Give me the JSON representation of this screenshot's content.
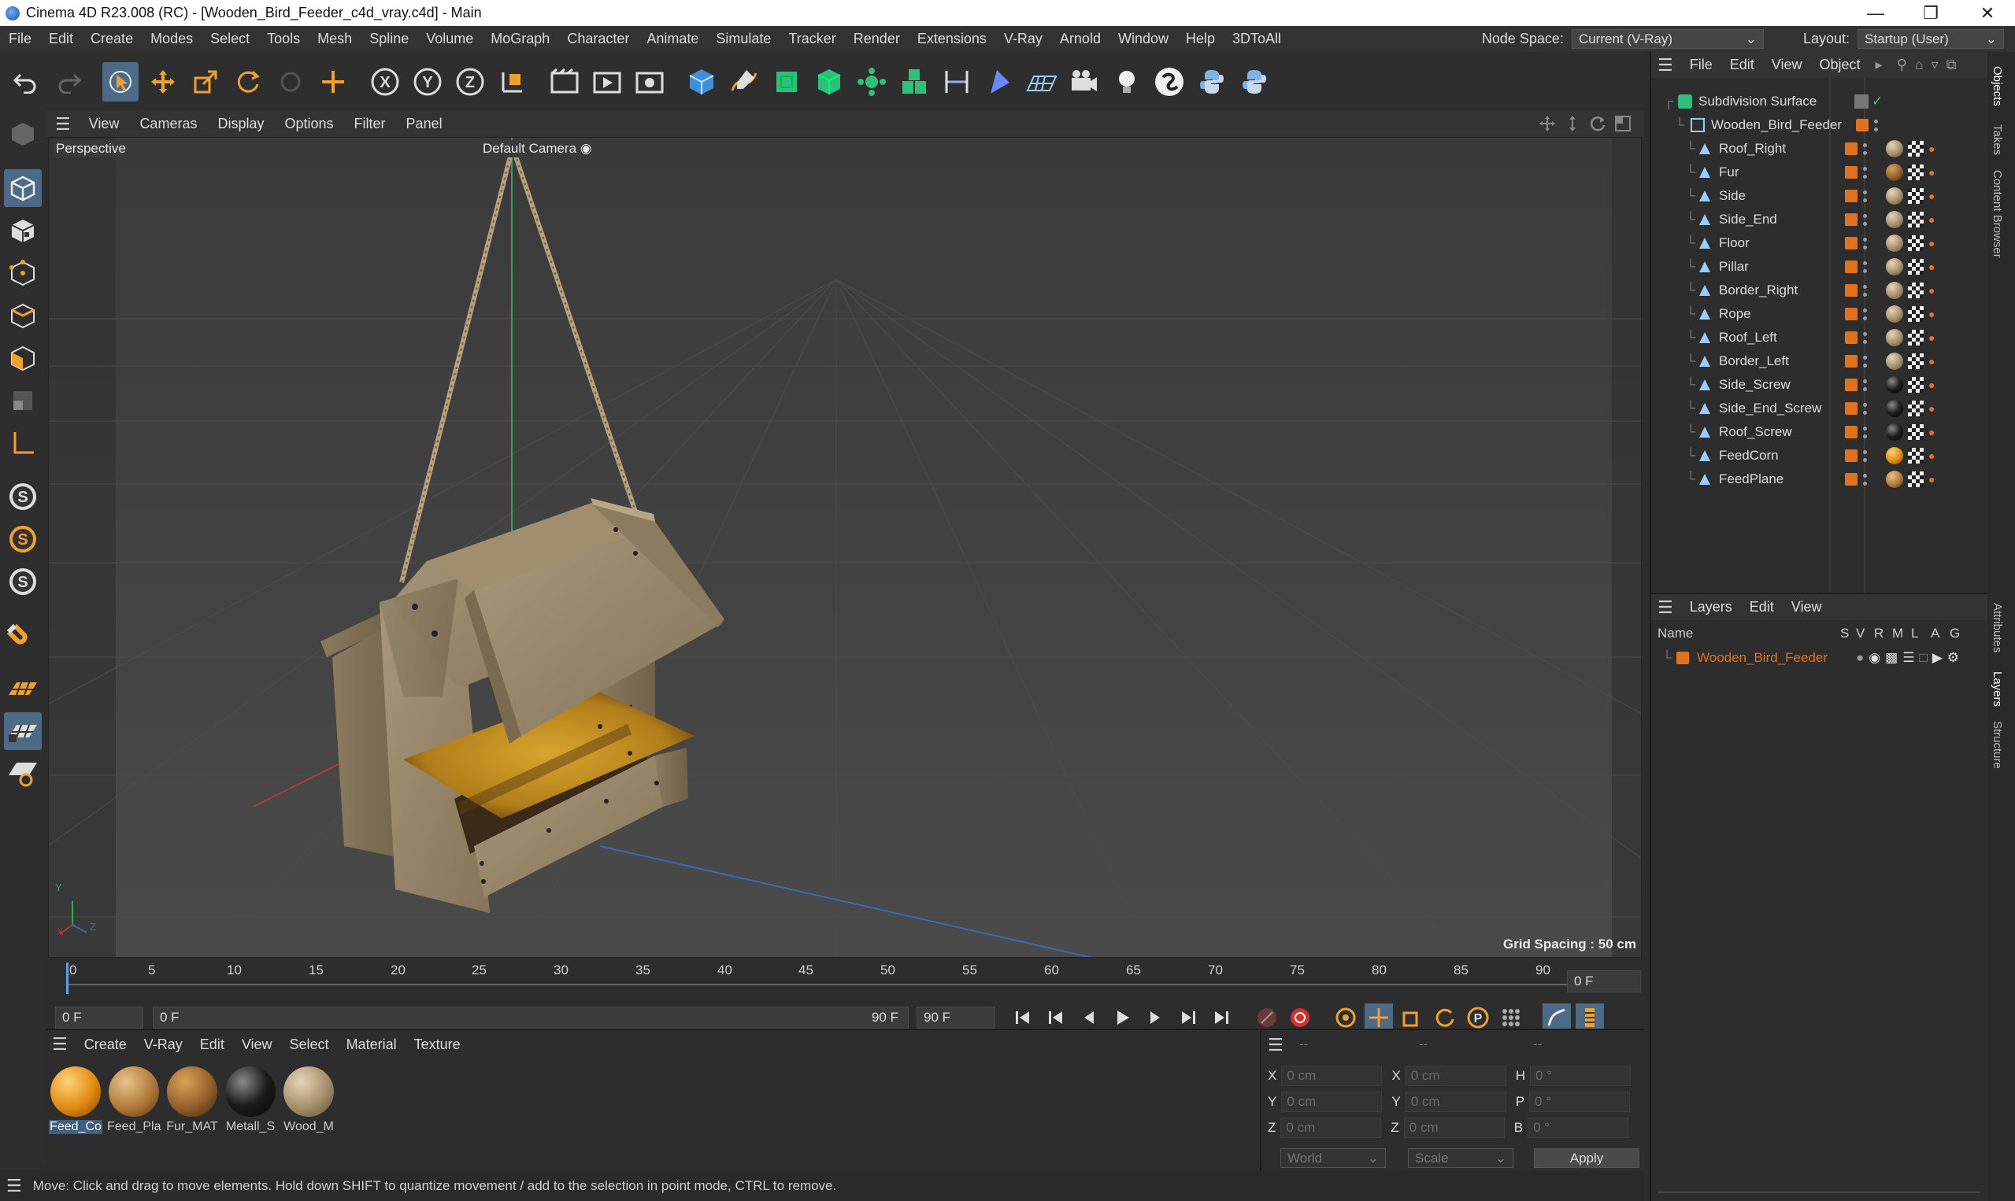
{
  "window": {
    "title": "Cinema 4D R23.008 (RC) - [Wooden_Bird_Feeder_c4d_vray.c4d] - Main"
  },
  "menu": [
    "File",
    "Edit",
    "Create",
    "Modes",
    "Select",
    "Tools",
    "Mesh",
    "Spline",
    "Volume",
    "MoGraph",
    "Character",
    "Animate",
    "Simulate",
    "Tracker",
    "Render",
    "Extensions",
    "V-Ray",
    "Arnold",
    "Window",
    "Help",
    "3DToAll"
  ],
  "node_space": {
    "label": "Node Space:",
    "value": "Current (V-Ray)"
  },
  "layout": {
    "label": "Layout:",
    "value": "Startup (User)"
  },
  "viewport": {
    "menu": [
      "View",
      "Cameras",
      "Display",
      "Options",
      "Filter",
      "Panel"
    ],
    "name": "Perspective",
    "camera": "Default Camera",
    "grid_spacing": "Grid Spacing : 50 cm",
    "axis_x": "X",
    "axis_y": "Y",
    "axis_z": "Z"
  },
  "timeline": {
    "ticks": [
      "0",
      "5",
      "10",
      "15",
      "20",
      "25",
      "30",
      "35",
      "40",
      "45",
      "50",
      "55",
      "60",
      "65",
      "70",
      "75",
      "80",
      "85",
      "90"
    ],
    "current": "0 F"
  },
  "transport": {
    "start": "0 F",
    "range_start": "0 F",
    "range_end": "90 F",
    "end": "90 F"
  },
  "materials": {
    "menu": [
      "Create",
      "V-Ray",
      "Edit",
      "View",
      "Select",
      "Material",
      "Texture"
    ],
    "items": [
      {
        "label": "Feed_Co"
      },
      {
        "label": "Feed_Pla"
      },
      {
        "label": "Fur_MAT"
      },
      {
        "label": "Metall_S"
      },
      {
        "label": "Wood_M"
      }
    ]
  },
  "coords": {
    "header": [
      "--",
      "--",
      "--"
    ],
    "rows": [
      {
        "a": "X",
        "av": "0 cm",
        "b": "X",
        "bv": "0 cm",
        "c": "H",
        "cv": "0 °"
      },
      {
        "a": "Y",
        "av": "0 cm",
        "b": "Y",
        "bv": "0 cm",
        "c": "P",
        "cv": "0 °"
      },
      {
        "a": "Z",
        "av": "0 cm",
        "b": "Z",
        "bv": "0 cm",
        "c": "B",
        "cv": "0 °"
      }
    ],
    "world": "World",
    "scale": "Scale",
    "apply": "Apply"
  },
  "status": "Move: Click and drag to move elements. Hold down SHIFT to quantize movement / add to the selection in point mode, CTRL to remove.",
  "objects": {
    "menu": [
      "File",
      "Edit",
      "View",
      "Object"
    ],
    "root": "Subdivision Surface",
    "group": "Wooden_Bird_Feeder",
    "children": [
      "Roof_Right",
      "Fur",
      "Side",
      "Side_End",
      "Floor",
      "Pillar",
      "Border_Right",
      "Rope",
      "Roof_Left",
      "Border_Left",
      "Side_Screw",
      "Side_End_Screw",
      "Roof_Screw",
      "FeedCorn",
      "FeedPlane"
    ]
  },
  "layers": {
    "menu": [
      "Layers",
      "Edit",
      "View"
    ],
    "columns": [
      "Name",
      "S",
      "V",
      "R",
      "M",
      "L",
      "A",
      "G"
    ],
    "items": [
      "Wooden_Bird_Feeder"
    ]
  },
  "right_tabs": [
    "Objects",
    "Takes",
    "Content Browser",
    "Attributes",
    "Layers",
    "Structure"
  ],
  "colors": {
    "accent": "#e2711d",
    "selection": "#4d6a86"
  }
}
